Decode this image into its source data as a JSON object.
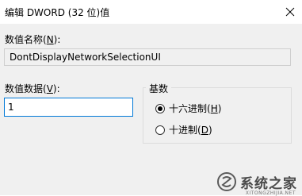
{
  "window": {
    "title": "编辑 DWORD (32 位)值",
    "close_icon": "close-icon"
  },
  "value_name": {
    "label_prefix": "数值名称(",
    "label_key": "N",
    "label_suffix": "):",
    "value": "DontDisplayNetworkSelectionUI"
  },
  "value_data": {
    "label_prefix": "数值数据(",
    "label_key": "V",
    "label_suffix": "):",
    "value": "1"
  },
  "base": {
    "legend": "基数",
    "options": [
      {
        "label_prefix": "十六进制(",
        "key": "H",
        "label_suffix": ")",
        "selected": true
      },
      {
        "label_prefix": "十进制(",
        "key": "D",
        "label_suffix": ")",
        "selected": false
      }
    ]
  },
  "watermark": {
    "text": "系统之家",
    "sub": "XITONGZHIJIA.NET"
  }
}
